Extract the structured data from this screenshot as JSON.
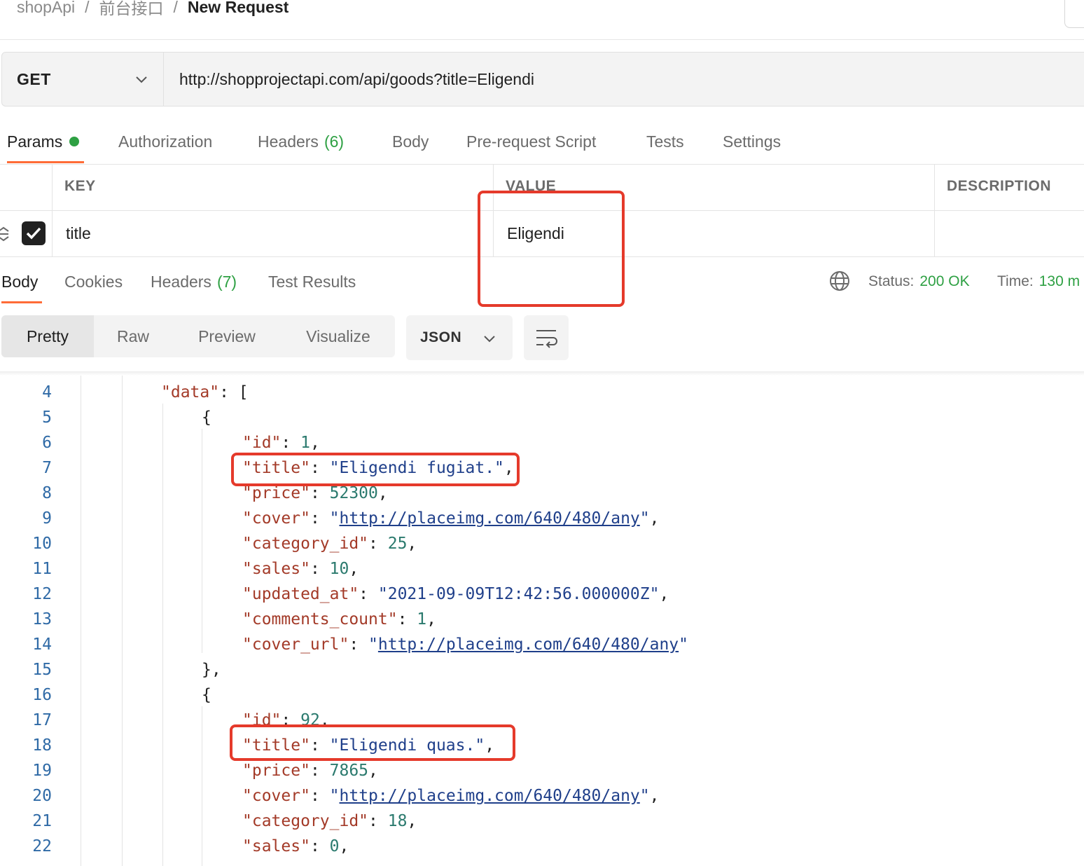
{
  "breadcrumb": {
    "items": [
      "shopApi",
      "前台接口"
    ],
    "separator": "/",
    "current": "New Request"
  },
  "request": {
    "method": "GET",
    "url": "http://shopprojectapi.com/api/goods?title=Eligendi"
  },
  "request_tabs": [
    {
      "label": "Params",
      "active": true,
      "dot": true
    },
    {
      "label": "Authorization"
    },
    {
      "label": "Headers",
      "count": "(6)"
    },
    {
      "label": "Body"
    },
    {
      "label": "Pre-request Script"
    },
    {
      "label": "Tests"
    },
    {
      "label": "Settings"
    }
  ],
  "params_table": {
    "headers": [
      "KEY",
      "VALUE",
      "DESCRIPTION"
    ],
    "rows": [
      {
        "checked": true,
        "key": "title",
        "value": "Eligendi",
        "description": ""
      }
    ]
  },
  "response_tabs": [
    {
      "label": "Body",
      "active": true
    },
    {
      "label": "Cookies"
    },
    {
      "label": "Headers",
      "count": "(7)"
    },
    {
      "label": "Test Results"
    }
  ],
  "response_status": {
    "status_label": "Status:",
    "status_value": "200 OK",
    "time_label": "Time:",
    "time_value": "130 m"
  },
  "view_modes": [
    "Pretty",
    "Raw",
    "Preview",
    "Visualize"
  ],
  "active_view_mode": "Pretty",
  "format": "JSON",
  "code_lines": [
    {
      "n": 4,
      "indent": 1,
      "tokens": [
        [
          "k",
          "\"data\""
        ],
        [
          "p",
          ": ["
        ]
      ]
    },
    {
      "n": 5,
      "indent": 2,
      "tokens": [
        [
          "p",
          "{"
        ]
      ]
    },
    {
      "n": 6,
      "indent": 3,
      "tokens": [
        [
          "k",
          "\"id\""
        ],
        [
          "p",
          ": "
        ],
        [
          "n",
          "1"
        ],
        [
          "p",
          ","
        ]
      ]
    },
    {
      "n": 7,
      "indent": 3,
      "tokens": [
        [
          "k",
          "\"title\""
        ],
        [
          "p",
          ": "
        ],
        [
          "s",
          "\"Eligendi fugiat.\""
        ],
        [
          "p",
          ","
        ]
      ]
    },
    {
      "n": 8,
      "indent": 3,
      "tokens": [
        [
          "k",
          "\"price\""
        ],
        [
          "p",
          ": "
        ],
        [
          "n",
          "52300"
        ],
        [
          "p",
          ","
        ]
      ]
    },
    {
      "n": 9,
      "indent": 3,
      "tokens": [
        [
          "k",
          "\"cover\""
        ],
        [
          "p",
          ": "
        ],
        [
          "s",
          "\""
        ],
        [
          "u",
          "http://placeimg.com/640/480/any"
        ],
        [
          "s",
          "\""
        ],
        [
          "p",
          ","
        ]
      ]
    },
    {
      "n": 10,
      "indent": 3,
      "tokens": [
        [
          "k",
          "\"category_id\""
        ],
        [
          "p",
          ": "
        ],
        [
          "n",
          "25"
        ],
        [
          "p",
          ","
        ]
      ]
    },
    {
      "n": 11,
      "indent": 3,
      "tokens": [
        [
          "k",
          "\"sales\""
        ],
        [
          "p",
          ": "
        ],
        [
          "n",
          "10"
        ],
        [
          "p",
          ","
        ]
      ]
    },
    {
      "n": 12,
      "indent": 3,
      "tokens": [
        [
          "k",
          "\"updated_at\""
        ],
        [
          "p",
          ": "
        ],
        [
          "s",
          "\"2021-09-09T12:42:56.000000Z\""
        ],
        [
          "p",
          ","
        ]
      ]
    },
    {
      "n": 13,
      "indent": 3,
      "tokens": [
        [
          "k",
          "\"comments_count\""
        ],
        [
          "p",
          ": "
        ],
        [
          "n",
          "1"
        ],
        [
          "p",
          ","
        ]
      ]
    },
    {
      "n": 14,
      "indent": 3,
      "tokens": [
        [
          "k",
          "\"cover_url\""
        ],
        [
          "p",
          ": "
        ],
        [
          "s",
          "\""
        ],
        [
          "u",
          "http://placeimg.com/640/480/any"
        ],
        [
          "s",
          "\""
        ]
      ]
    },
    {
      "n": 15,
      "indent": 2,
      "tokens": [
        [
          "p",
          "},"
        ]
      ]
    },
    {
      "n": 16,
      "indent": 2,
      "tokens": [
        [
          "p",
          "{"
        ]
      ]
    },
    {
      "n": 17,
      "indent": 3,
      "tokens": [
        [
          "k",
          "\"id\""
        ],
        [
          "p",
          ": "
        ],
        [
          "n",
          "92"
        ],
        [
          "p",
          ","
        ]
      ]
    },
    {
      "n": 18,
      "indent": 3,
      "tokens": [
        [
          "k",
          "\"title\""
        ],
        [
          "p",
          ": "
        ],
        [
          "s",
          "\"Eligendi quas.\""
        ],
        [
          "p",
          ","
        ]
      ]
    },
    {
      "n": 19,
      "indent": 3,
      "tokens": [
        [
          "k",
          "\"price\""
        ],
        [
          "p",
          ": "
        ],
        [
          "n",
          "7865"
        ],
        [
          "p",
          ","
        ]
      ]
    },
    {
      "n": 20,
      "indent": 3,
      "tokens": [
        [
          "k",
          "\"cover\""
        ],
        [
          "p",
          ": "
        ],
        [
          "s",
          "\""
        ],
        [
          "u",
          "http://placeimg.com/640/480/any"
        ],
        [
          "s",
          "\""
        ],
        [
          "p",
          ","
        ]
      ]
    },
    {
      "n": 21,
      "indent": 3,
      "tokens": [
        [
          "k",
          "\"category_id\""
        ],
        [
          "p",
          ": "
        ],
        [
          "n",
          "18"
        ],
        [
          "p",
          ","
        ]
      ]
    },
    {
      "n": 22,
      "indent": 3,
      "tokens": [
        [
          "k",
          "\"sales\""
        ],
        [
          "p",
          ": "
        ],
        [
          "n",
          "0"
        ],
        [
          "p",
          ","
        ]
      ]
    }
  ],
  "colors": {
    "accent": "#ff6c37",
    "success": "#2ea043",
    "highlight": "#e53a2b"
  }
}
